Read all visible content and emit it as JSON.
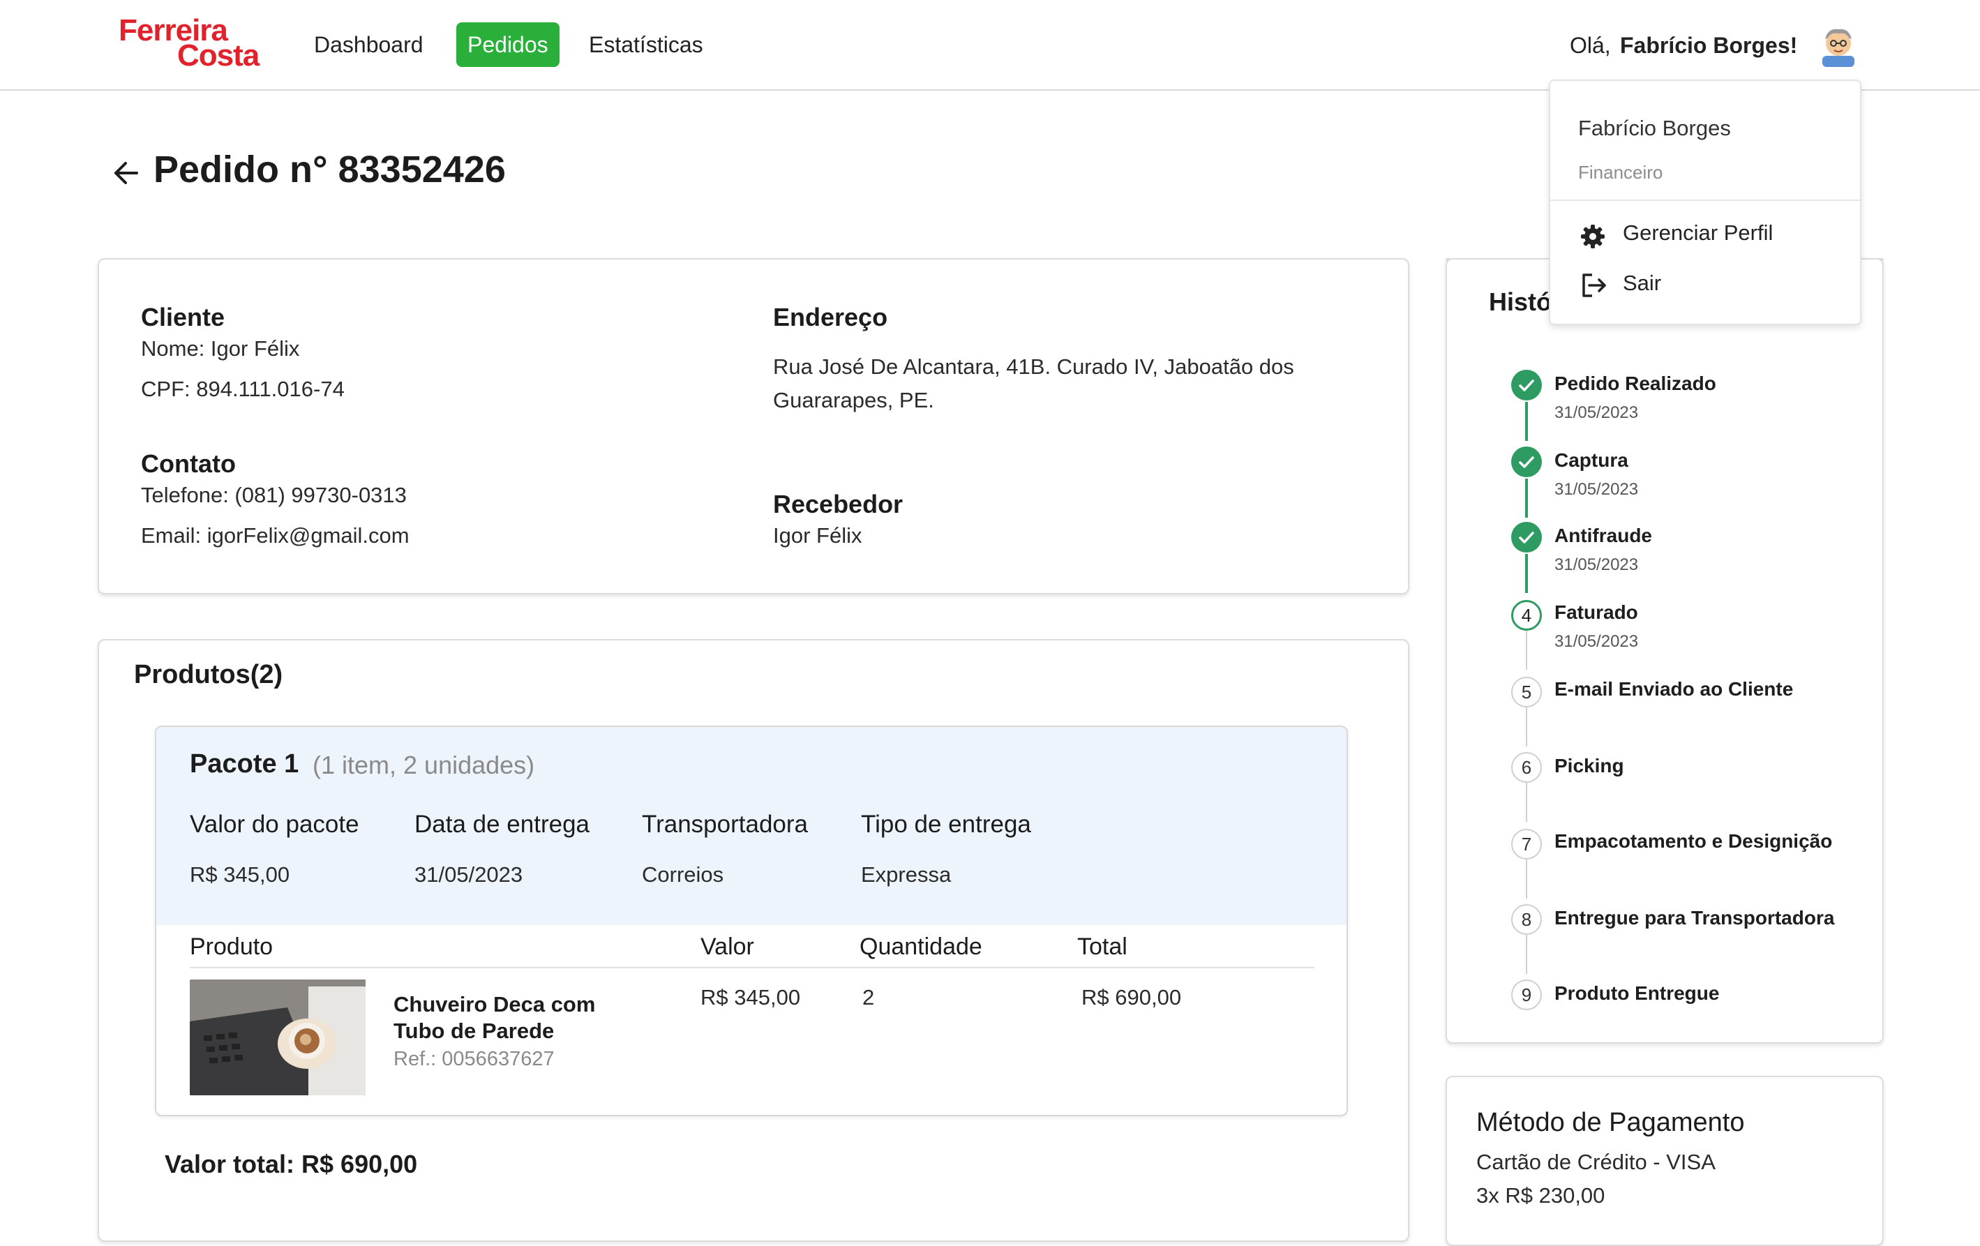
{
  "header": {
    "logo_line1": "Ferreira",
    "logo_line2": "Costa",
    "nav": [
      {
        "label": "Dashboard",
        "active": false
      },
      {
        "label": "Pedidos",
        "active": true
      },
      {
        "label": "Estatísticas",
        "active": false
      }
    ],
    "greeting_prefix": "Olá,",
    "user_name": "Fabrício Borges!"
  },
  "user_menu": {
    "name": "Fabrício Borges",
    "role": "Financeiro",
    "manage_label": "Gerenciar Perfil",
    "logout_label": "Sair"
  },
  "page": {
    "title": "Pedido n° 83352426"
  },
  "customer_card": {
    "client_heading": "Cliente",
    "client_name": "Nome: Igor Félix",
    "client_cpf": "CPF: 894.111.016-74",
    "contact_heading": "Contato",
    "contact_phone": "Telefone: (081) 99730-0313",
    "contact_email": "Email: igorFelix@gmail.com",
    "address_heading": "Endereço",
    "address_text": "Rua José De Alcantara, 41B. Curado IV, Jaboatão dos Guararapes, PE.",
    "receiver_heading": "Recebedor",
    "receiver_name": "Igor Félix"
  },
  "products": {
    "heading": "Produtos(2)",
    "package": {
      "title": "Pacote 1",
      "subtitle": "(1 item, 2 unidades)",
      "fields": [
        {
          "label": "Valor do pacote",
          "value": "R$ 345,00"
        },
        {
          "label": "Data de entrega",
          "value": "31/05/2023"
        },
        {
          "label": "Transportadora",
          "value": "Correios"
        },
        {
          "label": "Tipo de entrega",
          "value": "Expressa"
        }
      ],
      "columns": [
        "Produto",
        "Valor",
        "Quantidade",
        "Total"
      ],
      "items": [
        {
          "name_line1": "Chuveiro Deca com",
          "name_line2": "Tubo de Parede",
          "ref": "Ref.: 0056637627",
          "value": "R$ 345,00",
          "quantity": "2",
          "total": "R$ 690,00"
        }
      ]
    },
    "total_label": "Valor total: R$ 690,00"
  },
  "history": {
    "heading_visible": "Histó",
    "steps": [
      {
        "number": "1",
        "title": "Pedido Realizado",
        "date": "31/05/2023",
        "status": "done"
      },
      {
        "number": "2",
        "title": "Captura",
        "date": "31/05/2023",
        "status": "done"
      },
      {
        "number": "3",
        "title": "Antifraude",
        "date": "31/05/2023",
        "status": "done"
      },
      {
        "number": "4",
        "title": "Faturado",
        "date": "31/05/2023",
        "status": "current"
      },
      {
        "number": "5",
        "title": "E-mail Enviado ao Cliente",
        "date": "",
        "status": "pending"
      },
      {
        "number": "6",
        "title": "Picking",
        "date": "",
        "status": "pending"
      },
      {
        "number": "7",
        "title": "Empacotamento e Designição",
        "date": "",
        "status": "pending"
      },
      {
        "number": "8",
        "title": "Entregue para Transportadora",
        "date": "",
        "status": "pending"
      },
      {
        "number": "9",
        "title": "Produto Entregue",
        "date": "",
        "status": "pending"
      }
    ]
  },
  "payment": {
    "heading": "Método de Pagamento",
    "method": "Cartão de Crédito - VISA",
    "installments": "3x R$ 230,00"
  },
  "colors": {
    "brand_red": "#e2222a",
    "accent_green": "#2ab03a",
    "timeline_green": "#2e9b63",
    "package_bg": "#edf4fc"
  }
}
